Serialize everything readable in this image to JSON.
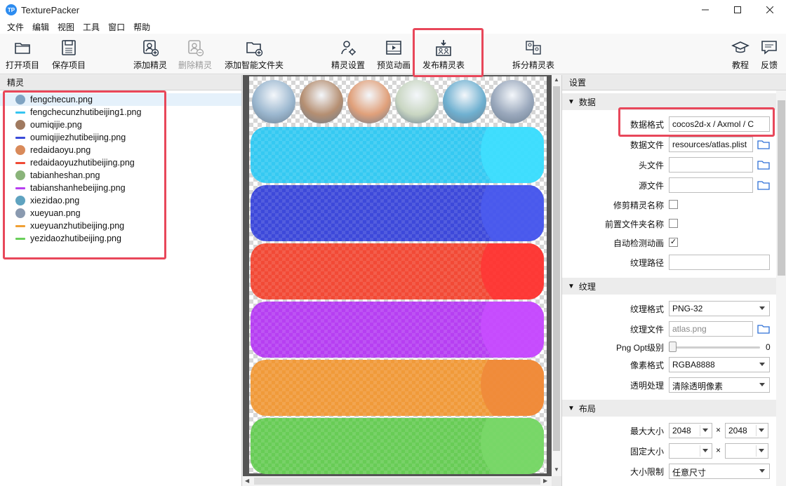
{
  "window": {
    "title": "TexturePacker",
    "logo_text": "TP"
  },
  "menu": [
    "文件",
    "编辑",
    "视图",
    "工具",
    "窗口",
    "帮助"
  ],
  "toolbar": {
    "open_project": "打开项目",
    "save_project": "保存项目",
    "add_sprite": "添加精灵",
    "remove_sprite": "删除精灵",
    "add_smart_folder": "添加智能文件夹",
    "sprite_settings": "精灵设置",
    "preview_animation": "预览动画",
    "publish_sheet": "发布精灵表",
    "split_sheet": "拆分精灵表",
    "tutorial": "教程",
    "feedback": "反馈"
  },
  "sprites_panel": {
    "title": "精灵",
    "items": [
      {
        "name": "fengchecun.png",
        "kind": "image",
        "color": "#7fa3c2"
      },
      {
        "name": "fengchecunzhutibeijing1.png",
        "kind": "bar",
        "color": "#35c5f0"
      },
      {
        "name": "oumiqijie.png",
        "kind": "image",
        "color": "#a07a60"
      },
      {
        "name": "oumiqijiezhutibeijing.png",
        "kind": "bar",
        "color": "#3b4bd8"
      },
      {
        "name": "redaidaoyu.png",
        "kind": "image",
        "color": "#d98a5a"
      },
      {
        "name": "redaidaoyuzhutibeijing.png",
        "kind": "bar",
        "color": "#f04a35"
      },
      {
        "name": "tabianheshan.png",
        "kind": "image",
        "color": "#8ab47a"
      },
      {
        "name": "tabianshanhebeijing.png",
        "kind": "bar",
        "color": "#b83ff0"
      },
      {
        "name": "xiezidao.png",
        "kind": "image",
        "color": "#5fa3c0"
      },
      {
        "name": "xueyuan.png",
        "kind": "image",
        "color": "#8a9ab0"
      },
      {
        "name": "xueyuanzhutibeijing.png",
        "kind": "bar",
        "color": "#f0a035"
      },
      {
        "name": "yezidaozhutibeijing.png",
        "kind": "bar",
        "color": "#6acf5a"
      }
    ]
  },
  "atlas": {
    "circles": [
      "#9bb7cf",
      "#b58f72",
      "#e0a07a",
      "#c9d6c2",
      "#6fb0d0",
      "#9aa8bc"
    ],
    "bars": [
      "#35c9f2",
      "#3d49da",
      "#f24a36",
      "#b63ff2",
      "#f09a3a",
      "#68cc56"
    ],
    "bar_glows": [
      "#3fe0ff",
      "#4b5cf0",
      "#ff3535",
      "#c94dff",
      "#f0883a",
      "#7ad86a"
    ]
  },
  "settings": {
    "title": "设置",
    "data_section": "数据",
    "data_format_label": "数据格式",
    "data_format_value": "cocos2d-x / Axmol / C",
    "data_file_label": "数据文件",
    "data_file_value": "resources/atlas.plist",
    "header_file_label": "头文件",
    "source_file_label": "源文件",
    "trim_sprite_names_label": "修剪精灵名称",
    "prepend_folder_label": "前置文件夹名称",
    "auto_detect_anim_label": "自动检测动画",
    "auto_detect_anim_check": "✓",
    "texture_path_label": "纹理路径",
    "texture_section": "纹理",
    "texture_format_label": "纹理格式",
    "texture_format_value": "PNG-32",
    "texture_file_label": "纹理文件",
    "texture_file_value": "atlas.png",
    "png_opt_label": "Png Opt级别",
    "png_opt_value": "0",
    "pixel_format_label": "像素格式",
    "pixel_format_value": "RGBA8888",
    "alpha_label": "透明处理",
    "alpha_value": "清除透明像素",
    "layout_section": "布局",
    "max_size_label": "最大大小",
    "max_w": "2048",
    "max_h": "2048",
    "fixed_size_label": "固定大小",
    "size_limit_label": "大小限制",
    "size_limit_value": "任意尺寸",
    "times": "×"
  },
  "colors": {
    "highlight": "#e8475a",
    "accent": "#2d8cf0"
  }
}
